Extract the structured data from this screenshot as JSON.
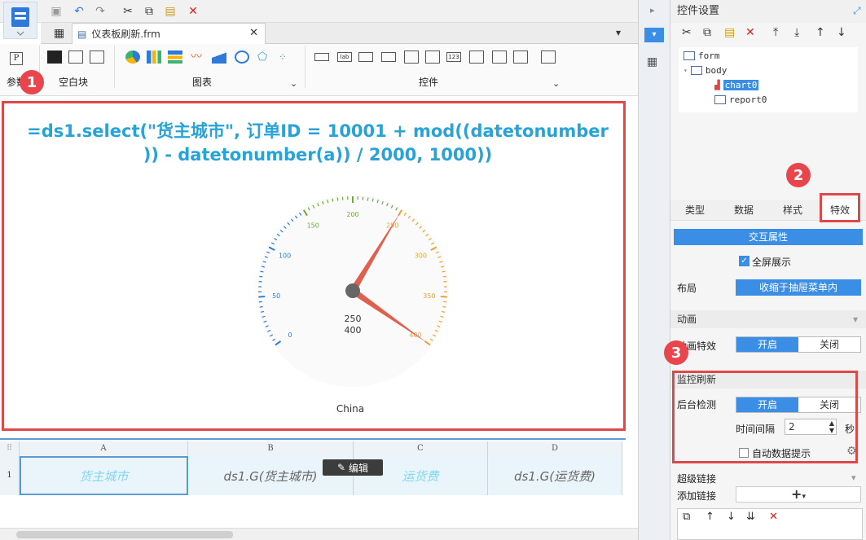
{
  "tab": {
    "title": "仪表板刷新.frm"
  },
  "ribbon": {
    "group_param": "参数",
    "group_blank": "空白块",
    "group_chart": "图表",
    "group_widget": "控件"
  },
  "canvas": {
    "formula_line1": "=ds1.select(\"货主城市\", 订单ID = 10001 + mod((datetonumber",
    "formula_line2": ")) - datetonumber(a)) / 2000, 1000))",
    "gauge_ticks": [
      "0",
      "50",
      "100",
      "150",
      "200",
      "250",
      "300",
      "350",
      "400"
    ],
    "gauge_value1": "250",
    "gauge_value2": "400",
    "category": "China"
  },
  "gauge_data": {
    "min": 0,
    "max": 400,
    "needle1": 250,
    "needle2": 400
  },
  "sheet": {
    "columns": [
      "A",
      "B",
      "C",
      "D"
    ],
    "row_number": "1",
    "cells": [
      "货主城市",
      "ds1.G(货主城市)",
      "运货费",
      "ds1.G(运货费)"
    ],
    "edit_label": "编辑"
  },
  "panel": {
    "title": "控件设置",
    "tree": [
      "form",
      "body",
      "chart0",
      "report0"
    ],
    "tabs": [
      "类型",
      "数据",
      "样式",
      "特效"
    ],
    "interaction_header": "交互属性",
    "fullscreen_label": "全屏展示",
    "layout_label": "布局",
    "layout_value": "收缩于抽屉菜单内",
    "animation_header": "动画",
    "animation_label": "动画特效",
    "on_label": "开启",
    "off_label": "关闭",
    "monitor_header": "监控刷新",
    "background_check_label": "后台检测",
    "interval_label": "时间间隔",
    "interval_value": "2",
    "interval_unit": "秒",
    "auto_tip_label": "自动数据提示",
    "hyperlink_header": "超级链接",
    "add_link_label": "添加链接",
    "add_link_btn": "+"
  },
  "markers": [
    "1",
    "2",
    "3"
  ],
  "colors": {
    "accent": "#3b8ee6",
    "formula": "#27a3d8",
    "highlight": "#e04848",
    "needle": "#e0604e"
  }
}
